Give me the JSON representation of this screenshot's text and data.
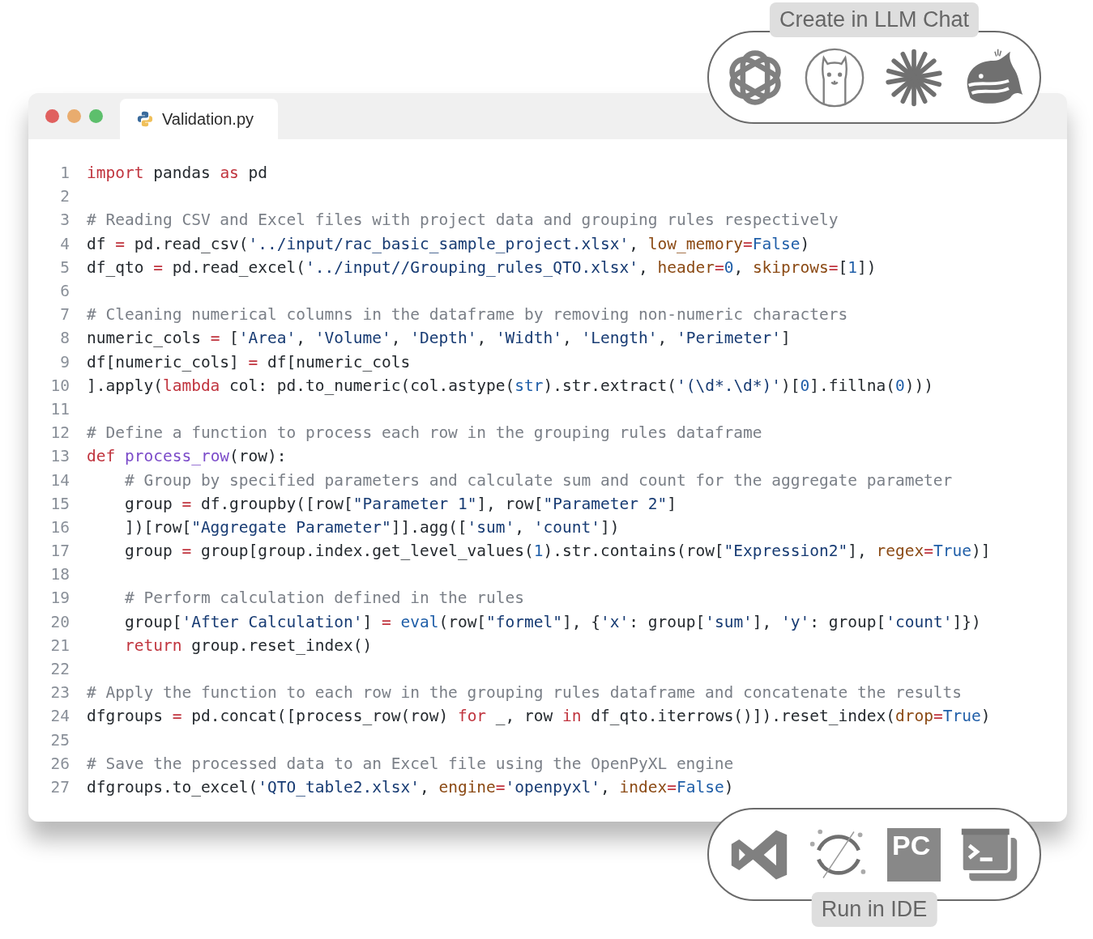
{
  "window": {
    "controls": [
      {
        "color": "#e0605f"
      },
      {
        "color": "#e9ac6e"
      },
      {
        "color": "#5dbf6c"
      }
    ],
    "tabs": [
      {
        "label": "Validation.py",
        "selected": true
      }
    ]
  },
  "code_lines": [
    {
      "number": "1",
      "tokens": [
        {
          "kind": "keyword",
          "text": "import"
        },
        {
          "kind": "plain",
          "text": " pandas "
        },
        {
          "kind": "keyword",
          "text": "as"
        },
        {
          "kind": "plain",
          "text": " pd"
        }
      ]
    },
    {
      "number": "2"
    },
    {
      "number": "3",
      "tokens": [
        {
          "kind": "comment",
          "text": "# Reading CSV and Excel files with project data and grouping rules respectively"
        }
      ]
    },
    {
      "number": "4",
      "tokens": [
        {
          "kind": "plain",
          "text": "df "
        },
        {
          "kind": "keyword",
          "text": "="
        },
        {
          "kind": "plain",
          "text": " pd.read_csv("
        },
        {
          "kind": "string",
          "text": "'../input/rac_basic_sample_project.xlsx'"
        },
        {
          "kind": "plain",
          "text": ", "
        },
        {
          "kind": "argument",
          "text": "low_memory"
        },
        {
          "kind": "keyword",
          "text": "="
        },
        {
          "kind": "constant",
          "text": "False"
        },
        {
          "kind": "plain",
          "text": ")"
        }
      ]
    },
    {
      "number": "5",
      "tokens": [
        {
          "kind": "plain",
          "text": "df_qto "
        },
        {
          "kind": "keyword",
          "text": "="
        },
        {
          "kind": "plain",
          "text": " pd.read_excel("
        },
        {
          "kind": "string",
          "text": "'../input//Grouping_rules_QTO.xlsx'"
        },
        {
          "kind": "plain",
          "text": ", "
        },
        {
          "kind": "argument",
          "text": "header"
        },
        {
          "kind": "keyword",
          "text": "="
        },
        {
          "kind": "constant",
          "text": "0"
        },
        {
          "kind": "plain",
          "text": ", "
        },
        {
          "kind": "argument",
          "text": "skiprows"
        },
        {
          "kind": "keyword",
          "text": "="
        },
        {
          "kind": "plain",
          "text": "["
        },
        {
          "kind": "constant",
          "text": "1"
        },
        {
          "kind": "plain",
          "text": "])"
        }
      ]
    },
    {
      "number": "6"
    },
    {
      "number": "7",
      "tokens": [
        {
          "kind": "comment",
          "text": "# Cleaning numerical columns in the dataframe by removing non-numeric characters"
        }
      ]
    },
    {
      "number": "8",
      "tokens": [
        {
          "kind": "plain",
          "text": "numeric_cols "
        },
        {
          "kind": "keyword",
          "text": "="
        },
        {
          "kind": "plain",
          "text": " ["
        },
        {
          "kind": "string",
          "text": "'Area'"
        },
        {
          "kind": "plain",
          "text": ", "
        },
        {
          "kind": "string",
          "text": "'Volume'"
        },
        {
          "kind": "plain",
          "text": ", "
        },
        {
          "kind": "string",
          "text": "'Depth'"
        },
        {
          "kind": "plain",
          "text": ", "
        },
        {
          "kind": "string",
          "text": "'Width'"
        },
        {
          "kind": "plain",
          "text": ", "
        },
        {
          "kind": "string",
          "text": "'Length'"
        },
        {
          "kind": "plain",
          "text": ", "
        },
        {
          "kind": "string",
          "text": "'Perimeter'"
        },
        {
          "kind": "plain",
          "text": "]"
        }
      ]
    },
    {
      "number": "9",
      "tokens": [
        {
          "kind": "plain",
          "text": "df[numeric_cols] "
        },
        {
          "kind": "keyword",
          "text": "="
        },
        {
          "kind": "plain",
          "text": " df[numeric_cols"
        }
      ]
    },
    {
      "number": "10",
      "tokens": [
        {
          "kind": "plain",
          "text": "].apply("
        },
        {
          "kind": "keyword",
          "text": "lambda"
        },
        {
          "kind": "plain",
          "text": " col: pd.to_numeric(col.astype("
        },
        {
          "kind": "builtin",
          "text": "str"
        },
        {
          "kind": "plain",
          "text": ").str.extract("
        },
        {
          "kind": "string",
          "text": "'(\\d*.\\d*)'"
        },
        {
          "kind": "plain",
          "text": ")["
        },
        {
          "kind": "constant",
          "text": "0"
        },
        {
          "kind": "plain",
          "text": "].fillna("
        },
        {
          "kind": "constant",
          "text": "0"
        },
        {
          "kind": "plain",
          "text": ")))"
        }
      ]
    },
    {
      "number": "11"
    },
    {
      "number": "12",
      "tokens": [
        {
          "kind": "comment",
          "text": "# Define a function to process each row in the grouping rules dataframe"
        }
      ]
    },
    {
      "number": "13",
      "tokens": [
        {
          "kind": "keyword",
          "text": "def "
        },
        {
          "kind": "function",
          "text": "process_row"
        },
        {
          "kind": "plain",
          "text": "(row):"
        }
      ]
    },
    {
      "number": "14",
      "tokens": [
        {
          "kind": "comment",
          "text": "    # Group by specified parameters and calculate sum and count for the aggregate parameter"
        }
      ]
    },
    {
      "number": "15",
      "tokens": [
        {
          "kind": "plain",
          "text": "    group "
        },
        {
          "kind": "keyword",
          "text": "="
        },
        {
          "kind": "plain",
          "text": " df.groupby([row["
        },
        {
          "kind": "string",
          "text": "\"Parameter 1\""
        },
        {
          "kind": "plain",
          "text": "], row["
        },
        {
          "kind": "string",
          "text": "\"Parameter 2\""
        },
        {
          "kind": "plain",
          "text": "]"
        }
      ]
    },
    {
      "number": "16",
      "tokens": [
        {
          "kind": "plain",
          "text": "    ])[row["
        },
        {
          "kind": "string",
          "text": "\"Aggregate Parameter\""
        },
        {
          "kind": "plain",
          "text": "]].agg(["
        },
        {
          "kind": "string",
          "text": "'sum'"
        },
        {
          "kind": "plain",
          "text": ", "
        },
        {
          "kind": "string",
          "text": "'count'"
        },
        {
          "kind": "plain",
          "text": "])"
        }
      ]
    },
    {
      "number": "17",
      "tokens": [
        {
          "kind": "plain",
          "text": "    group "
        },
        {
          "kind": "keyword",
          "text": "="
        },
        {
          "kind": "plain",
          "text": " group[group.index.get_level_values("
        },
        {
          "kind": "constant",
          "text": "1"
        },
        {
          "kind": "plain",
          "text": ").str.contains(row["
        },
        {
          "kind": "string",
          "text": "\"Expression2\""
        },
        {
          "kind": "plain",
          "text": "], "
        },
        {
          "kind": "argument",
          "text": "regex"
        },
        {
          "kind": "keyword",
          "text": "="
        },
        {
          "kind": "constant",
          "text": "True"
        },
        {
          "kind": "plain",
          "text": ")]"
        }
      ]
    },
    {
      "number": "18"
    },
    {
      "number": "19",
      "tokens": [
        {
          "kind": "comment",
          "text": "    # Perform calculation defined in the rules"
        }
      ]
    },
    {
      "number": "20",
      "tokens": [
        {
          "kind": "plain",
          "text": "    group["
        },
        {
          "kind": "string",
          "text": "'After Calculation'"
        },
        {
          "kind": "plain",
          "text": "] "
        },
        {
          "kind": "keyword",
          "text": "= "
        },
        {
          "kind": "builtin",
          "text": "eval"
        },
        {
          "kind": "plain",
          "text": "(row["
        },
        {
          "kind": "string",
          "text": "\"formel\""
        },
        {
          "kind": "plain",
          "text": "], {"
        },
        {
          "kind": "string",
          "text": "'x'"
        },
        {
          "kind": "plain",
          "text": ": group["
        },
        {
          "kind": "string",
          "text": "'sum'"
        },
        {
          "kind": "plain",
          "text": "], "
        },
        {
          "kind": "string",
          "text": "'y'"
        },
        {
          "kind": "plain",
          "text": ": group["
        },
        {
          "kind": "string",
          "text": "'count'"
        },
        {
          "kind": "plain",
          "text": "]})"
        }
      ]
    },
    {
      "number": "21",
      "tokens": [
        {
          "kind": "keyword",
          "text": "    return"
        },
        {
          "kind": "plain",
          "text": " group.reset_index()"
        }
      ]
    },
    {
      "number": "22"
    },
    {
      "number": "23",
      "tokens": [
        {
          "kind": "comment",
          "text": "# Apply the function to each row in the grouping rules dataframe and concatenate the results"
        }
      ]
    },
    {
      "number": "24",
      "tokens": [
        {
          "kind": "plain",
          "text": "dfgroups "
        },
        {
          "kind": "keyword",
          "text": "="
        },
        {
          "kind": "plain",
          "text": " pd.concat([process_row(row) "
        },
        {
          "kind": "keyword",
          "text": "for"
        },
        {
          "kind": "plain",
          "text": " _, row "
        },
        {
          "kind": "keyword",
          "text": "in"
        },
        {
          "kind": "plain",
          "text": " df_qto.iterrows()]).reset_index("
        },
        {
          "kind": "argument",
          "text": "drop"
        },
        {
          "kind": "keyword",
          "text": "="
        },
        {
          "kind": "constant",
          "text": "True"
        },
        {
          "kind": "plain",
          "text": ")"
        }
      ]
    },
    {
      "number": "25"
    },
    {
      "number": "26",
      "tokens": [
        {
          "kind": "comment",
          "text": "# Save the processed data to an Excel file using the OpenPyXL engine"
        }
      ]
    },
    {
      "number": "27",
      "tokens": [
        {
          "kind": "plain",
          "text": "dfgroups.to_excel("
        },
        {
          "kind": "string",
          "text": "'QTO_table2.xlsx'"
        },
        {
          "kind": "plain",
          "text": ", "
        },
        {
          "kind": "argument",
          "text": "engine"
        },
        {
          "kind": "keyword",
          "text": "="
        },
        {
          "kind": "string",
          "text": "'openpyxl'"
        },
        {
          "kind": "plain",
          "text": ", "
        },
        {
          "kind": "argument",
          "text": "index"
        },
        {
          "kind": "keyword",
          "text": "="
        },
        {
          "kind": "constant",
          "text": "False"
        },
        {
          "kind": "plain",
          "text": ")"
        }
      ]
    }
  ],
  "llm_panel": {
    "label": "Create in LLM Chat"
  },
  "ide_panel": {
    "label": "Run in IDE",
    "logo_text": "PC"
  }
}
